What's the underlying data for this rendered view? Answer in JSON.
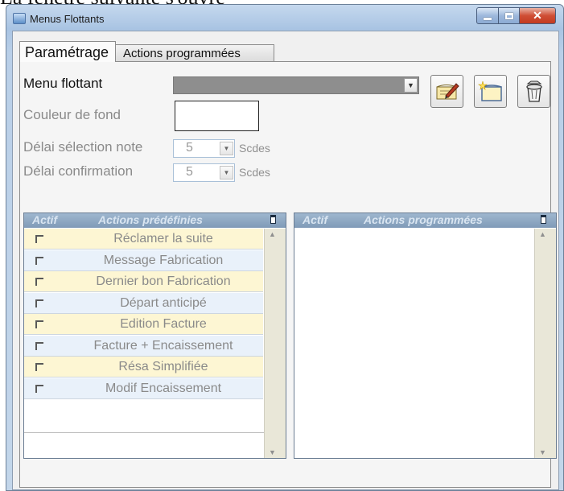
{
  "caption": "La fenêtre suivante s'ouvre",
  "window": {
    "title": "Menus Flottants"
  },
  "tabs": [
    {
      "label": "Paramétrage",
      "active": true
    },
    {
      "label": "Actions programmées",
      "active": false
    }
  ],
  "form": {
    "menu_label": "Menu flottant",
    "menu_value": "",
    "couleur_label": "Couleur de fond",
    "delai_note_label": "Délai sélection note",
    "delai_note_value": "5",
    "delai_conf_label": "Délai confirmation",
    "delai_conf_value": "5",
    "unit": "Scdes"
  },
  "predefined": {
    "col_actif": "Actif",
    "col_title": "Actions prédéfinies",
    "rows": [
      {
        "label": "Réclamer la suite",
        "checked": false
      },
      {
        "label": "Message Fabrication",
        "checked": false
      },
      {
        "label": "Dernier bon Fabrication",
        "checked": false
      },
      {
        "label": "Départ anticipé",
        "checked": false
      },
      {
        "label": "Edition Facture",
        "checked": false
      },
      {
        "label": "Facture + Encaissement",
        "checked": false
      },
      {
        "label": "Résa Simplifiée",
        "checked": false
      },
      {
        "label": "Modif Encaissement",
        "checked": false
      }
    ]
  },
  "programmed": {
    "col_actif": "Actif",
    "col_title": "Actions programmées",
    "rows": []
  },
  "colors": {
    "row_alt_1": "#fdf6d3",
    "row_alt_2": "#e9f1fa",
    "grid_header": "#8aa3bf",
    "close_button": "#c8432a"
  },
  "icons": [
    "window-app-icon",
    "edit-note-icon",
    "new-note-icon",
    "trash-icon"
  ]
}
